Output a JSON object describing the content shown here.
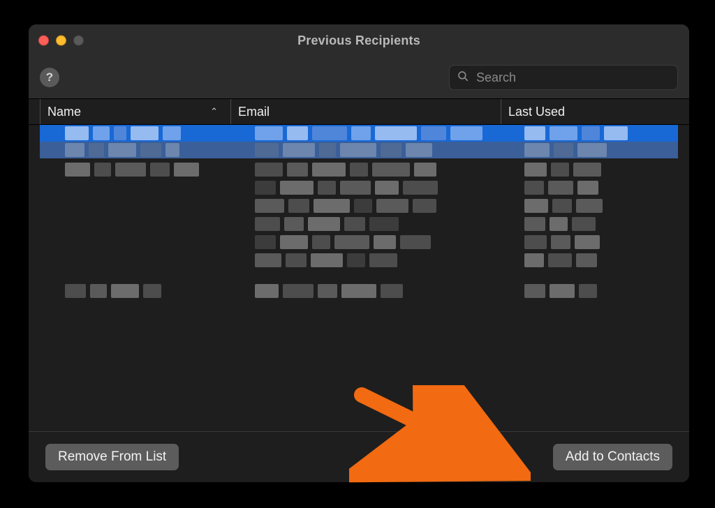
{
  "window": {
    "title": "Previous Recipients"
  },
  "toolbar": {
    "help_glyph": "?",
    "search": {
      "placeholder": "Search",
      "value": ""
    }
  },
  "columns": {
    "name": "Name",
    "email": "Email",
    "last_used": "Last Used",
    "sort_indicator": "⌃"
  },
  "footer": {
    "remove_label": "Remove From List",
    "add_label": "Add to Contacts"
  },
  "annotation": {
    "arrow_color": "#f26a11"
  }
}
